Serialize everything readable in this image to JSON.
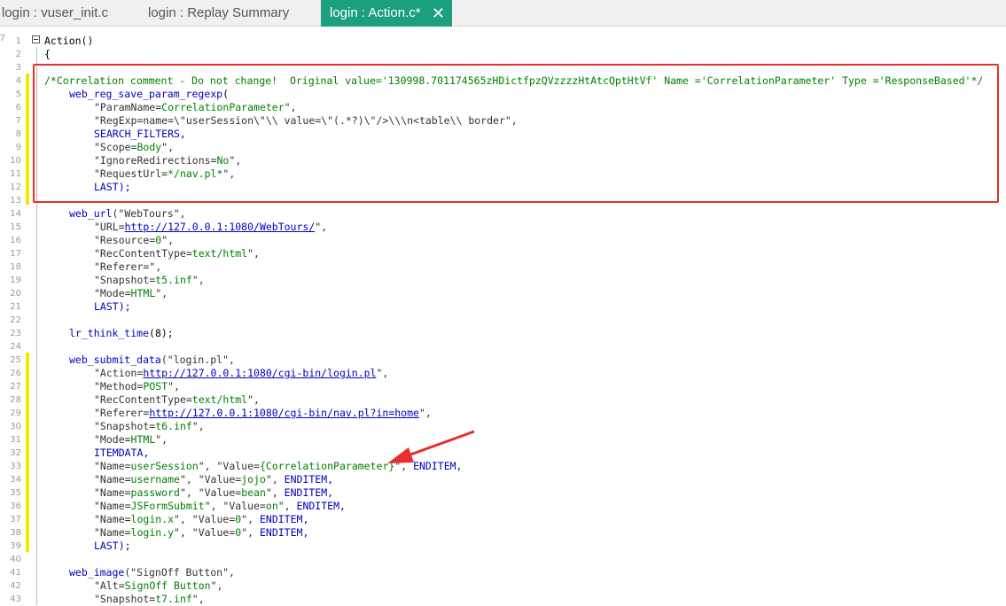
{
  "tabs": [
    {
      "label": "login : vuser_init.c"
    },
    {
      "label": "login : Replay Summary"
    },
    {
      "label": "login : Action.c*",
      "active": true,
      "close_glyph": "✕"
    }
  ],
  "gutter_mark": "7",
  "line_numbers": [
    "1",
    "2",
    "3",
    "4",
    "5",
    "6",
    "7",
    "8",
    "9",
    "10",
    "11",
    "12",
    "13",
    "14",
    "15",
    "16",
    "17",
    "18",
    "19",
    "20",
    "21",
    "22",
    "23",
    "24",
    "25",
    "26",
    "27",
    "28",
    "29",
    "30",
    "31",
    "32",
    "33",
    "34",
    "35",
    "36",
    "37",
    "38",
    "39",
    "40",
    "41",
    "42",
    "43"
  ],
  "accent_color": "#1a9f7f",
  "highlight_color": "#e5302b",
  "arrow_color": "#e5302b",
  "code": {
    "l1": "Action()",
    "l2": "{",
    "l4": "/*Correlation comment - Do not change!  Original value='130998.701174565zHDictfpzQVzzzzHtAtcQptHtVf' Name ='CorrelationParameter' Type ='ResponseBased'*/",
    "l5_fn": "web_reg_save_param_regexp",
    "l5_p": "(",
    "l6_a": "\"ParamName=",
    "l6_b": "CorrelationParameter",
    "l6_c": "\",",
    "l7_a": "\"RegExp=name=\\\"userSession\\\"\\\\ value=\\\"(.*?)\\\"/>\\\\\\n<table\\\\ border\",",
    "l8": "SEARCH_FILTERS,",
    "l9_a": "\"Scope=",
    "l9_b": "Body",
    "l9_c": "\",",
    "l10_a": "\"IgnoreRedirections=",
    "l10_b": "No",
    "l10_c": "\",",
    "l11_a": "\"RequestUrl=",
    "l11_b": "*/nav.pl*",
    "l11_c": "\",",
    "l12": "LAST);",
    "l14_fn": "web_url",
    "l14_a": "(\"WebTours\",",
    "l15_a": "\"URL=",
    "l15_b": "http://127.0.0.1:1080/WebTours/",
    "l15_c": "\",",
    "l16_a": "\"Resource=",
    "l16_b": "0",
    "l16_c": "\",",
    "l17_a": "\"RecContentType=",
    "l17_b": "text/html",
    "l17_c": "\",",
    "l18": "\"Referer=\",",
    "l19_a": "\"Snapshot=",
    "l19_b": "t5.inf",
    "l19_c": "\",",
    "l20_a": "\"Mode=",
    "l20_b": "HTML",
    "l20_c": "\",",
    "l21": "LAST);",
    "l23_fn": "lr_think_time",
    "l23_a": "(8);",
    "l25_fn": "web_submit_data",
    "l25_a": "(\"login.pl\",",
    "l26_a": "\"Action=",
    "l26_b": "http://127.0.0.1:1080/cgi-bin/login.pl",
    "l26_c": "\",",
    "l27_a": "\"Method=",
    "l27_b": "POST",
    "l27_c": "\",",
    "l28_a": "\"RecContentType=",
    "l28_b": "text/html",
    "l28_c": "\",",
    "l29_a": "\"Referer=",
    "l29_b": "http://127.0.0.1:1080/cgi-bin/nav.pl?in=home",
    "l29_c": "\",",
    "l30_a": "\"Snapshot=",
    "l30_b": "t6.inf",
    "l30_c": "\",",
    "l31_a": "\"Mode=",
    "l31_b": "HTML",
    "l31_c": "\",",
    "l32": "ITEMDATA,",
    "l33_a": "\"Name=",
    "l33_b": "userSession",
    "l33_c": "\", \"Value=",
    "l33_d": "{CorrelationParameter}",
    "l33_e": "\", ",
    "l33_f": "ENDITEM,",
    "l34_a": "\"Name=",
    "l34_b": "username",
    "l34_c": "\", \"Value=",
    "l34_d": "jojo",
    "l34_e": "\", ",
    "l34_f": "ENDITEM,",
    "l35_a": "\"Name=",
    "l35_b": "password",
    "l35_c": "\", \"Value=",
    "l35_d": "bean",
    "l35_e": "\", ",
    "l35_f": "ENDITEM,",
    "l36_a": "\"Name=",
    "l36_b": "JSFormSubmit",
    "l36_c": "\", \"Value=",
    "l36_d": "on",
    "l36_e": "\", ",
    "l36_f": "ENDITEM,",
    "l37_a": "\"Name=",
    "l37_b": "login.x",
    "l37_c": "\", \"Value=",
    "l37_d": "0",
    "l37_e": "\", ",
    "l37_f": "ENDITEM,",
    "l38_a": "\"Name=",
    "l38_b": "login.y",
    "l38_c": "\", \"Value=",
    "l38_d": "0",
    "l38_e": "\", ",
    "l38_f": "ENDITEM,",
    "l39": "LAST);",
    "l41_fn": "web_image",
    "l41_a": "(\"SignOff Button\",",
    "l42_a": "\"Alt=",
    "l42_b": "SignOff Button",
    "l42_c": "\",",
    "l43_a": "\"Snapshot=",
    "l43_b": "t7.inf",
    "l43_c": "\","
  }
}
